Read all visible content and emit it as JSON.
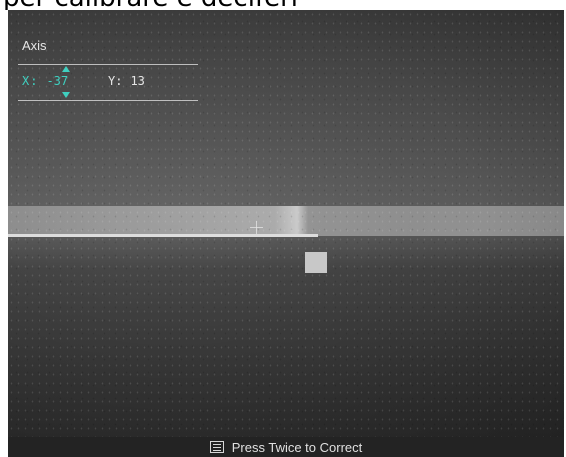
{
  "caption": "per calibrare e deciferi",
  "axis_panel": {
    "title": "Axis",
    "x": {
      "label": "X:",
      "value": "-37"
    },
    "y": {
      "label": "Y:",
      "value": "13"
    }
  },
  "status_bar": {
    "icon": "menu-list-icon",
    "hint": "Press Twice to Correct"
  },
  "colors": {
    "accent": "#3fd0c0",
    "text": "#e6e6e6"
  }
}
